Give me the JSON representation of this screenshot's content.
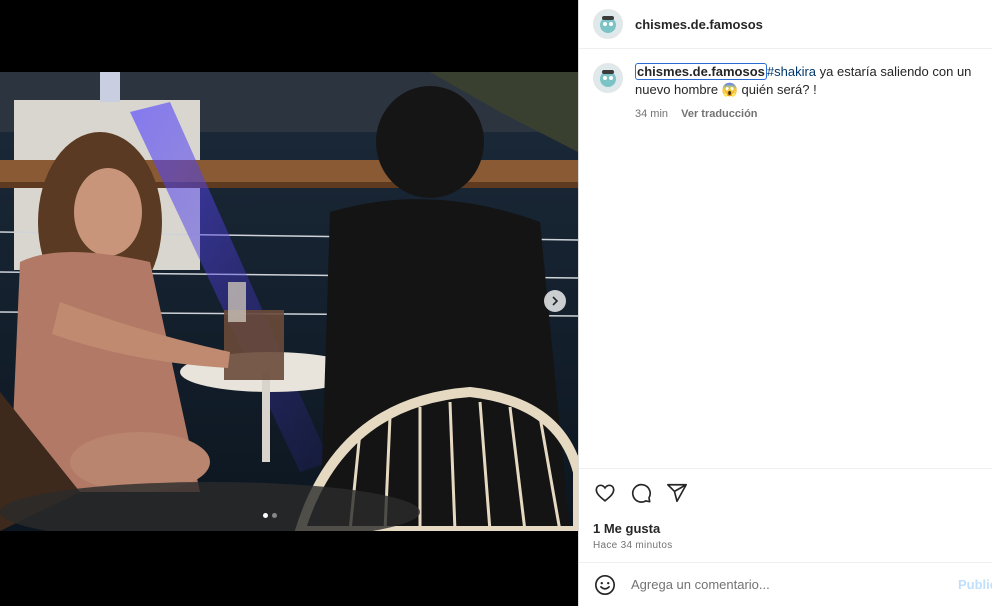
{
  "post": {
    "username": "chismes.de.famosos",
    "caption": {
      "user": "chismes.de.famosos",
      "hashtag": "#shakira",
      "text": " ya estaría saliendo con un nuevo hombre 😱 quién será? !"
    },
    "time_ago": "34 min",
    "translate_label": "Ver traducción",
    "likes": "1 Me gusta",
    "timestamp": "Hace 34 minutos"
  },
  "carousel": {
    "current": 1,
    "total": 2
  },
  "comment": {
    "placeholder": "Agrega un comentario...",
    "post_label": "Publicar"
  },
  "icons": {
    "like": "heart-icon",
    "comment": "comment-icon",
    "share": "paper-plane-icon",
    "emoji": "emoji-icon",
    "next": "chevron-right-icon"
  },
  "colors": {
    "hashtag": "#00376b",
    "post_button": "#c0dffd",
    "focus_outline": "#2b6bd6"
  }
}
